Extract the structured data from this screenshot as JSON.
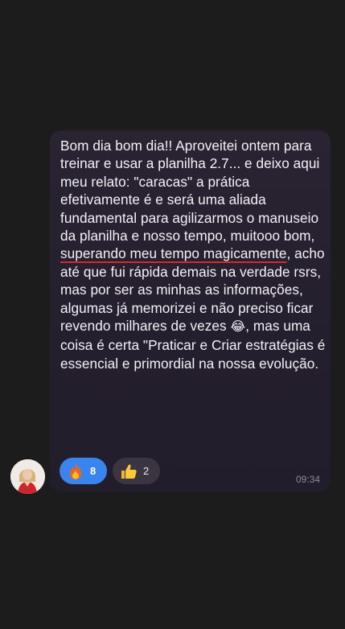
{
  "chat": {
    "message": {
      "lines": {
        "p1": "Bom dia bom dia!! Aproveitei ontem para treinar e usar a planilha 2.7... e deixo aqui meu relato: \"caracas\" a prática efetivamente é e será uma aliada fundamental para agilizarmos o manuseio da planilha e nosso tempo, muitooo bom, ",
        "underlined": "superando meu tempo magicamente",
        "p2": ", acho até que fui rápida demais na verdade rsrs, mas por ser as minhas as informações, algumas já memorizei e não preciso ficar revendo milhares de vezes ",
        "emoji": "😂",
        "p3": ", mas uma coisa é certa \"Praticar e Criar estratégias é essencial e primordial na nossa evolução."
      },
      "time": "09:34"
    },
    "reactions": [
      {
        "icon": "fire-icon",
        "count": "8",
        "active": true
      },
      {
        "icon": "thumbs-up-icon",
        "count": "2",
        "active": false
      }
    ],
    "colors": {
      "bubble": "#2a2332",
      "background": "#1c1c1d",
      "active_reaction": "#3a84ee",
      "underline": "#d42a2a"
    }
  }
}
